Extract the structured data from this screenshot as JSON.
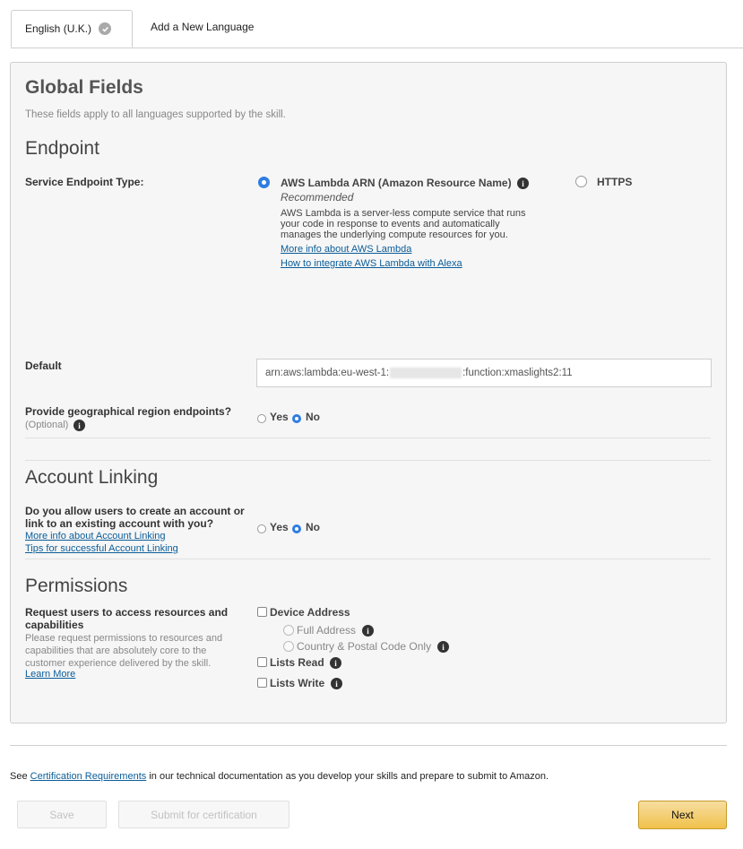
{
  "tabs": {
    "active_label": "English (U.K.)",
    "add_label": "Add a New Language"
  },
  "global": {
    "title": "Global Fields",
    "subtitle": "These fields apply to all languages supported by the skill."
  },
  "endpoint": {
    "heading": "Endpoint",
    "type_label": "Service Endpoint Type:",
    "lambda_option": "AWS Lambda ARN (Amazon Resource Name)",
    "lambda_selected": true,
    "recommended": "Recommended",
    "lambda_desc": "AWS Lambda is a server-less compute service that runs your code in response to events and automatically manages the underlying compute resources for you.",
    "link_more_info": "More info about AWS Lambda",
    "link_integrate": "How to integrate AWS Lambda with Alexa",
    "https_option": "HTTPS",
    "default_label": "Default",
    "default_value_prefix": "arn:aws:lambda:eu-west-1:",
    "default_value_suffix": ":function:xmaslights2:11",
    "geo_label": "Provide geographical region endpoints?",
    "geo_optional": "(Optional)",
    "geo_yes": "Yes",
    "geo_no": "No",
    "geo_selected": "No"
  },
  "account_linking": {
    "heading": "Account Linking",
    "question_line1": "Do you allow users to create an account or",
    "question_line2": "link to an existing account with you?",
    "link_more_info": "More info about Account Linking",
    "link_tips": "Tips for successful Account Linking",
    "yes": "Yes",
    "no": "No",
    "selected": "No"
  },
  "permissions": {
    "heading": "Permissions",
    "request_label_line1": "Request users to access resources and",
    "request_label_line2": "capabilities",
    "desc": "Please request permissions to resources and capabilities that are absolutely core to the customer experience delivered by the skill.",
    "learn_more": "Learn More",
    "device_address": "Device Address",
    "full_address": "Full Address",
    "country_postal": "Country & Postal Code Only",
    "lists_read": "Lists Read",
    "lists_write": "Lists Write"
  },
  "footer": {
    "see": "See",
    "cert_link": "Certification Requirements",
    "rest": "in our technical documentation as you develop your skills and prepare to submit to Amazon.",
    "save": "Save",
    "submit": "Submit for certification",
    "next": "Next"
  },
  "icons": {
    "check": "check-circle-icon",
    "info": "info-icon"
  },
  "colors": {
    "radio_selected": "#2e7de2",
    "link": "#0a5d99",
    "next_button": "#f0c14b"
  }
}
